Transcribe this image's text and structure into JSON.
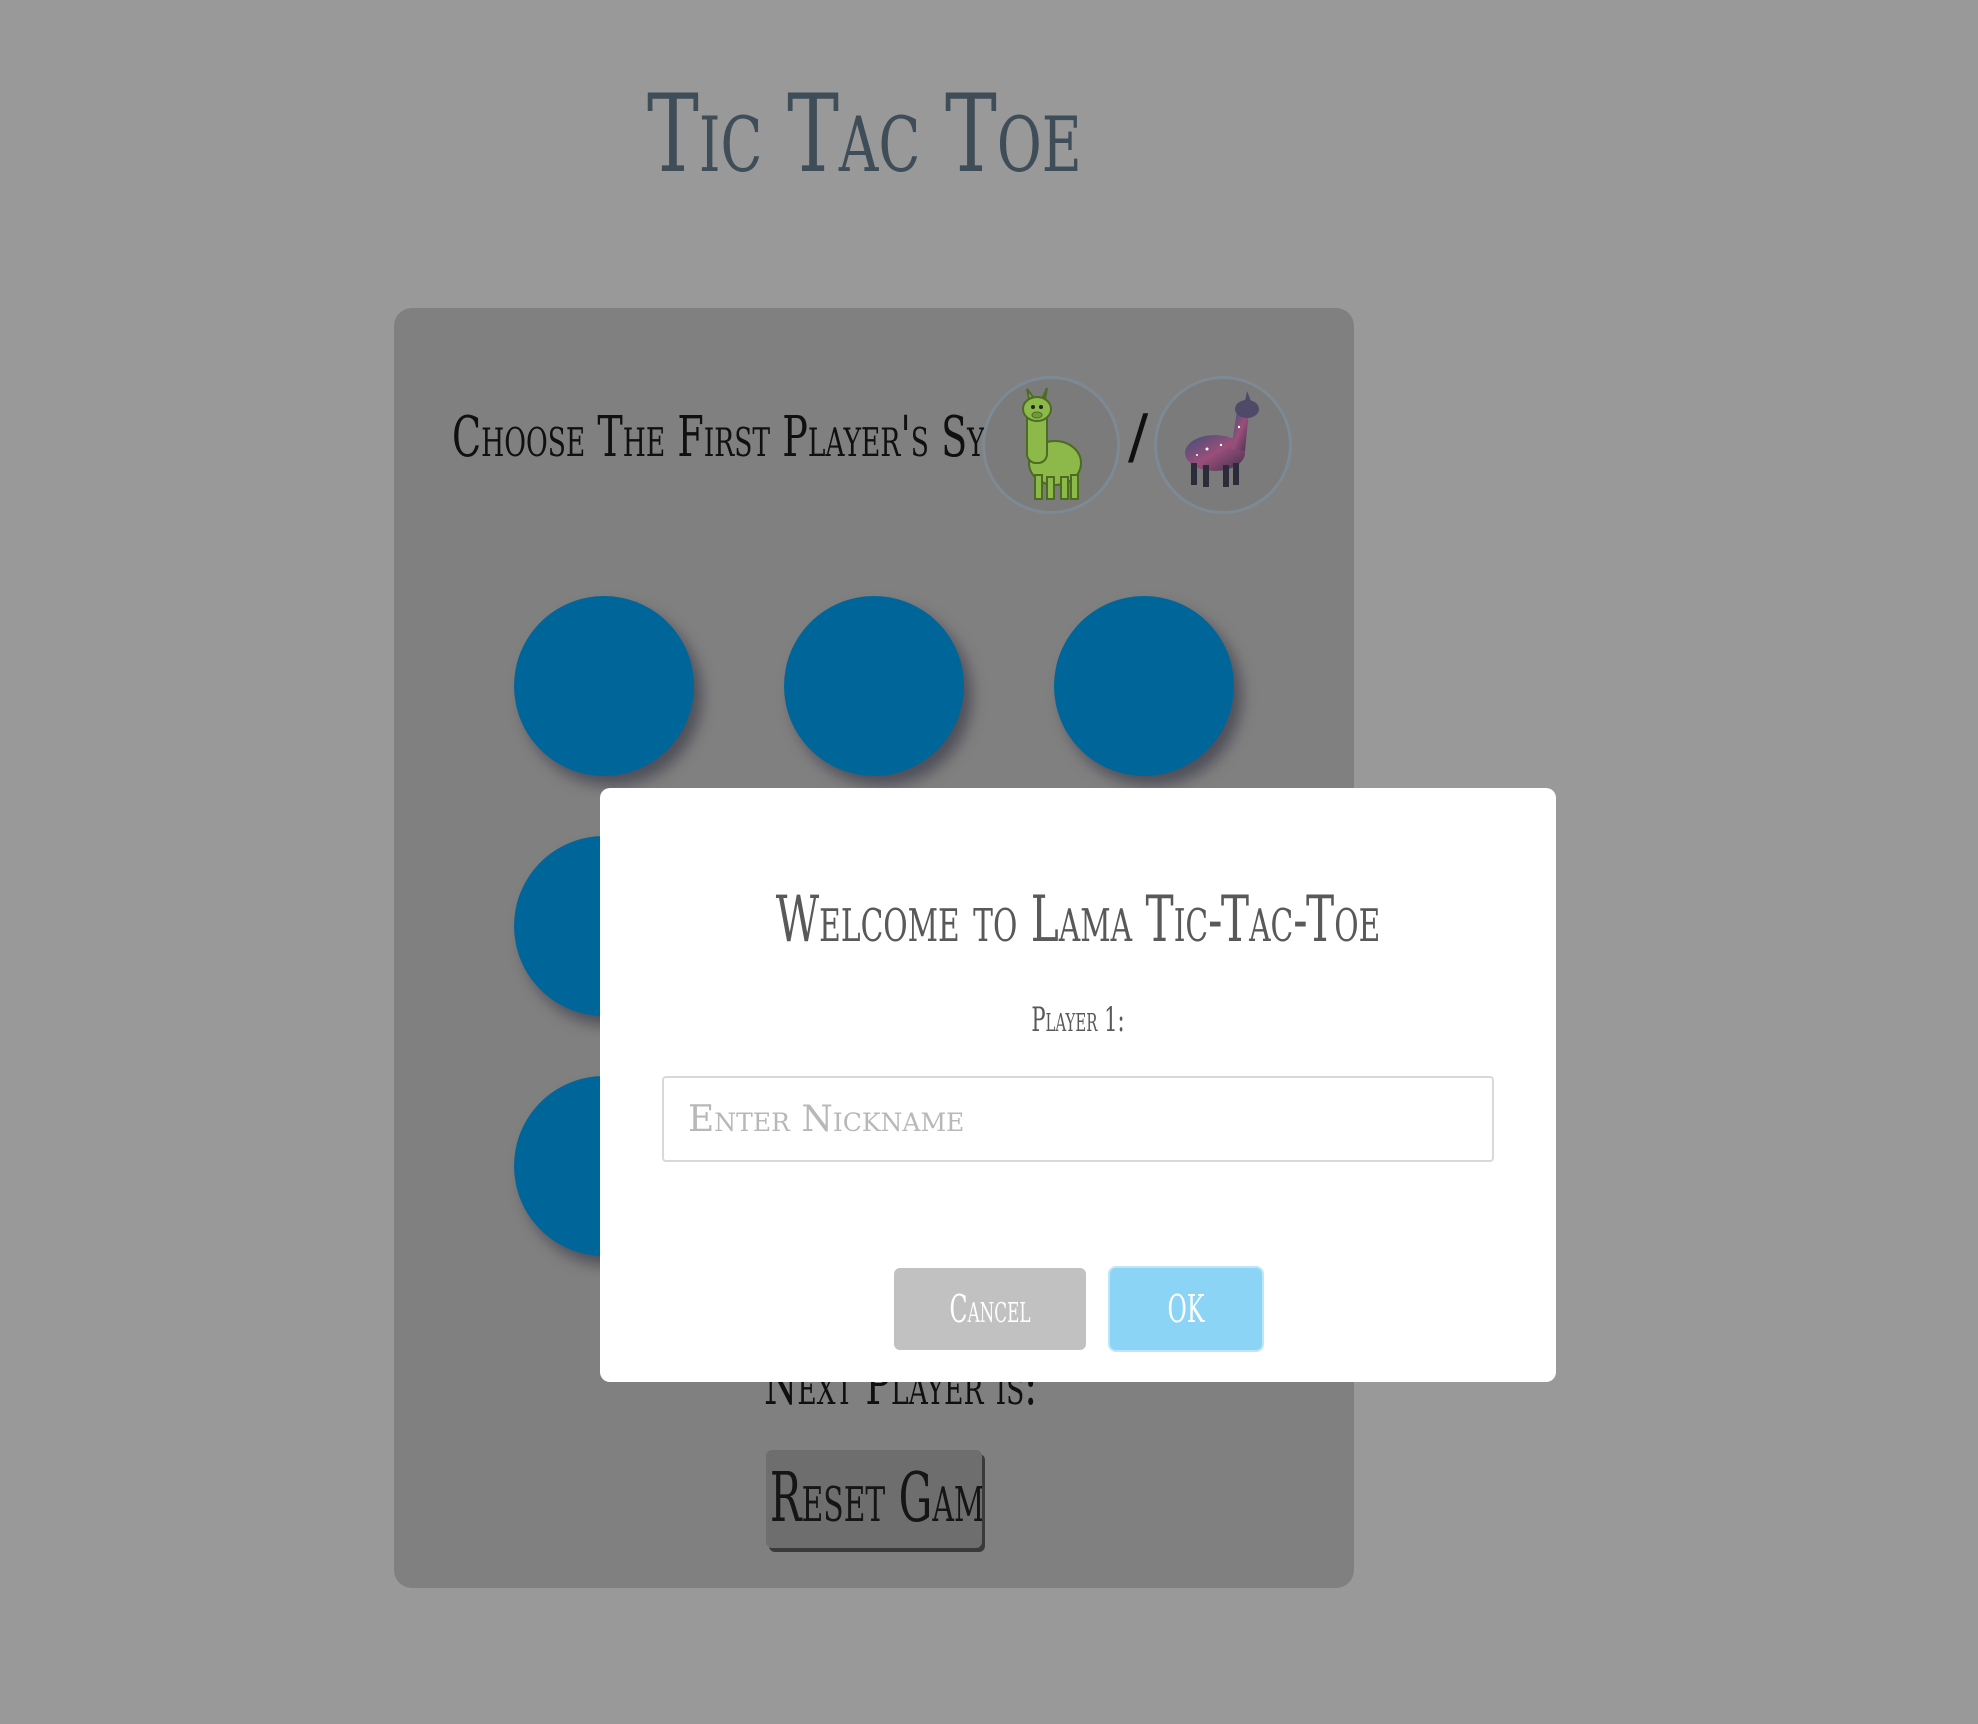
{
  "page": {
    "title": "Tic Tac Toe",
    "background_color": "#999999"
  },
  "board": {
    "symbol_label": "Choose  The First Player's Symbol",
    "symbol_separator": "/",
    "symbols": [
      {
        "name": "green-llama-icon",
        "color": "#8db84a"
      },
      {
        "name": "galaxy-llama-icon",
        "color": "#7a4a7a"
      }
    ],
    "cell_color": "#006699",
    "cells": [
      "",
      "",
      "",
      "",
      "",
      "",
      "",
      "",
      ""
    ],
    "next_player_text": "Next Player is:",
    "reset_label": "Reset Game"
  },
  "modal": {
    "title": "Welcome to Lama Tic-Tac-Toe",
    "player_label": "Player 1:",
    "input_placeholder": "Enter Nickname",
    "input_value": "",
    "cancel_label": "Cancel",
    "ok_label": "OK",
    "ok_color": "#8cd4f5",
    "cancel_color": "#c1c1c1"
  }
}
